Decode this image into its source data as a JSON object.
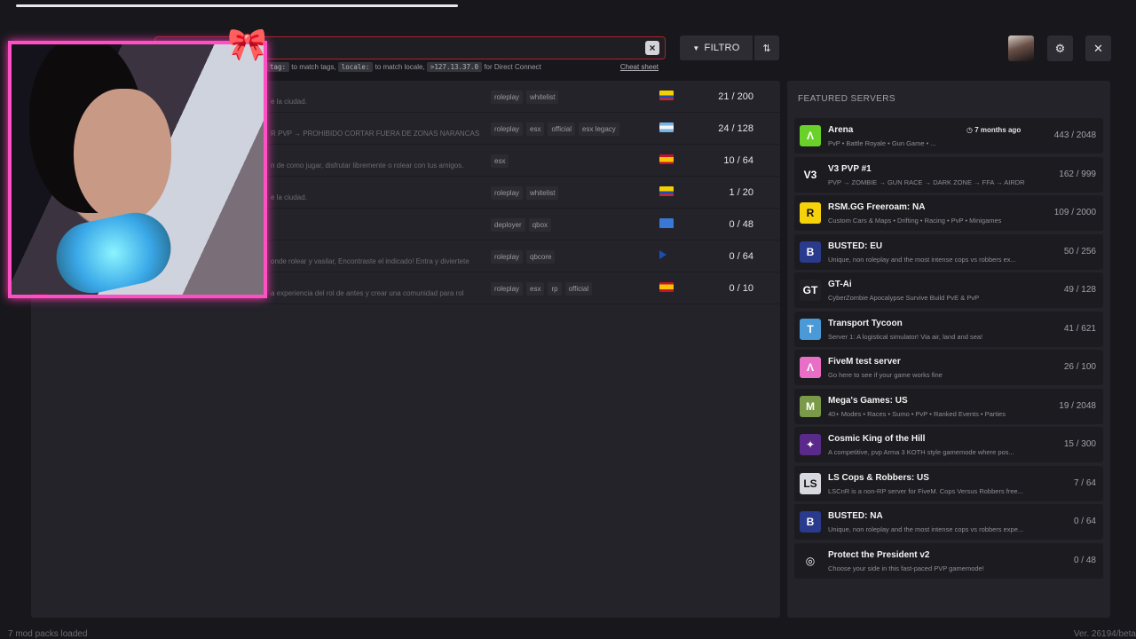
{
  "search": {
    "hint_tags_code": "tag:",
    "hint_tags_text": "to match tags,",
    "hint_locale_code": "locale:",
    "hint_locale_text": "to match locale,",
    "hint_ip_code": ">127.13.37.0",
    "hint_ip_text": "for Direct Connect",
    "cheat_sheet": "Cheat sheet",
    "clear_label": "×"
  },
  "toolbar": {
    "filter_label": "FILTRO",
    "filter_icon": "▼",
    "sort_icon": "⇅",
    "settings_icon": "⚙",
    "close_icon": "✕"
  },
  "servers": [
    {
      "desc": "e la ciudad.",
      "tags": [
        "roleplay",
        "whitelist"
      ],
      "flag": "ec",
      "count": "21 / 200"
    },
    {
      "desc": "R PVP → PROHIBIDO CORTAR FUERA DE ZONAS NARANCAS",
      "tags": [
        "roleplay",
        "esx",
        "official",
        "esx legacy"
      ],
      "flag": "ar",
      "count": "24 / 128"
    },
    {
      "desc": "n de como jugar, disfrutar libremente o rolear con tus amigos.",
      "tags": [
        "esx"
      ],
      "flag": "es",
      "count": "10 / 64"
    },
    {
      "desc": "e la ciudad.",
      "tags": [
        "roleplay",
        "whitelist"
      ],
      "flag": "ec",
      "count": "1 / 20"
    },
    {
      "desc": "",
      "tags": [
        "deployer",
        "qbox"
      ],
      "flag": "aq",
      "count": "0 / 48"
    },
    {
      "desc": "onde rolear y vasilar, Encontraste el indicado! Entra y diviertete",
      "tags": [
        "roleplay",
        "qbcore"
      ],
      "flag": "pr",
      "count": "0 / 64"
    },
    {
      "desc": "a experiencia del rol de antes y crear una comunidad para rol",
      "tags": [
        "roleplay",
        "esx",
        "rp",
        "official"
      ],
      "flag": "es",
      "count": "0 / 10"
    }
  ],
  "featured": {
    "title": "FEATURED SERVERS",
    "items": [
      {
        "name": "Arena",
        "desc": "PvP • Battle Royale • Gun Game • ...",
        "count": "443 / 2048",
        "badge": "◷ 7 months ago",
        "icon_color": "#6ad12a",
        "icon_glyph": "Λ"
      },
      {
        "name": "V3 PVP #1",
        "desc": "PVP → ZOMBIE → GUN RACE → DARK ZONE → FFA → AIRDROP",
        "count": "162 / 999",
        "icon_color": "#1b1b20",
        "icon_glyph": "V3"
      },
      {
        "name": "RSM.GG Freeroam: NA",
        "desc": "Custom Cars & Maps • Drifting • Racing • PvP • Minigames",
        "count": "109 / 2000",
        "icon_color": "#f5d20a",
        "icon_glyph": "R"
      },
      {
        "name": "BUSTED: EU",
        "desc": "Unique, non roleplay and the most intense cops vs robbers ex...",
        "count": "50 / 256",
        "icon_color": "#2a3a8c",
        "icon_glyph": "B"
      },
      {
        "name": "GT-Ai",
        "desc": "CyberZombie Apocalypse Survive Build PvE & PvP",
        "count": "49 / 128",
        "icon_color": "#222226",
        "icon_glyph": "GT"
      },
      {
        "name": "Transport Tycoon",
        "desc": "Server 1: A logistical simulator! Via air, land and sea!",
        "count": "41 / 621",
        "icon_color": "#4a9ad8",
        "icon_glyph": "T"
      },
      {
        "name": "FiveM test server",
        "desc": "Go here to see if your game works fine",
        "count": "26 / 100",
        "icon_color": "#e96fc6",
        "icon_glyph": "Λ"
      },
      {
        "name": "Mega's Games: US",
        "desc": "40+ Modes • Races • Sumo • PvP • Ranked Events • Parties",
        "count": "19 / 2048",
        "icon_color": "#7a9a4a",
        "icon_glyph": "M"
      },
      {
        "name": "Cosmic King of the Hill",
        "desc": "A competitive, pvp Arma 3 KOTH style gamemode where pos...",
        "count": "15 / 300",
        "icon_color": "#5a2a8a",
        "icon_glyph": "✦"
      },
      {
        "name": "LS Cops & Robbers: US",
        "desc": "LSCnR is a non-RP server for FiveM. Cops Versus Robbers free...",
        "count": "7 / 64",
        "icon_color": "#d8d8e0",
        "icon_glyph": "LS"
      },
      {
        "name": "BUSTED: NA",
        "desc": "Unique, non roleplay and the most intense cops vs robbers expe...",
        "count": "0 / 64",
        "icon_color": "#2a3a8c",
        "icon_glyph": "B"
      },
      {
        "name": "Protect the President v2",
        "desc": "Choose your side in this fast-paced PVP gamemode!",
        "count": "0 / 48",
        "icon_color": "#1b1b20",
        "icon_glyph": "◎"
      }
    ]
  },
  "footer": {
    "left": "7 mod packs loaded",
    "right": "Ver. 26194/beta"
  },
  "webcam": {
    "hearts": "❤❤♡♡",
    "bow": "🎀"
  }
}
